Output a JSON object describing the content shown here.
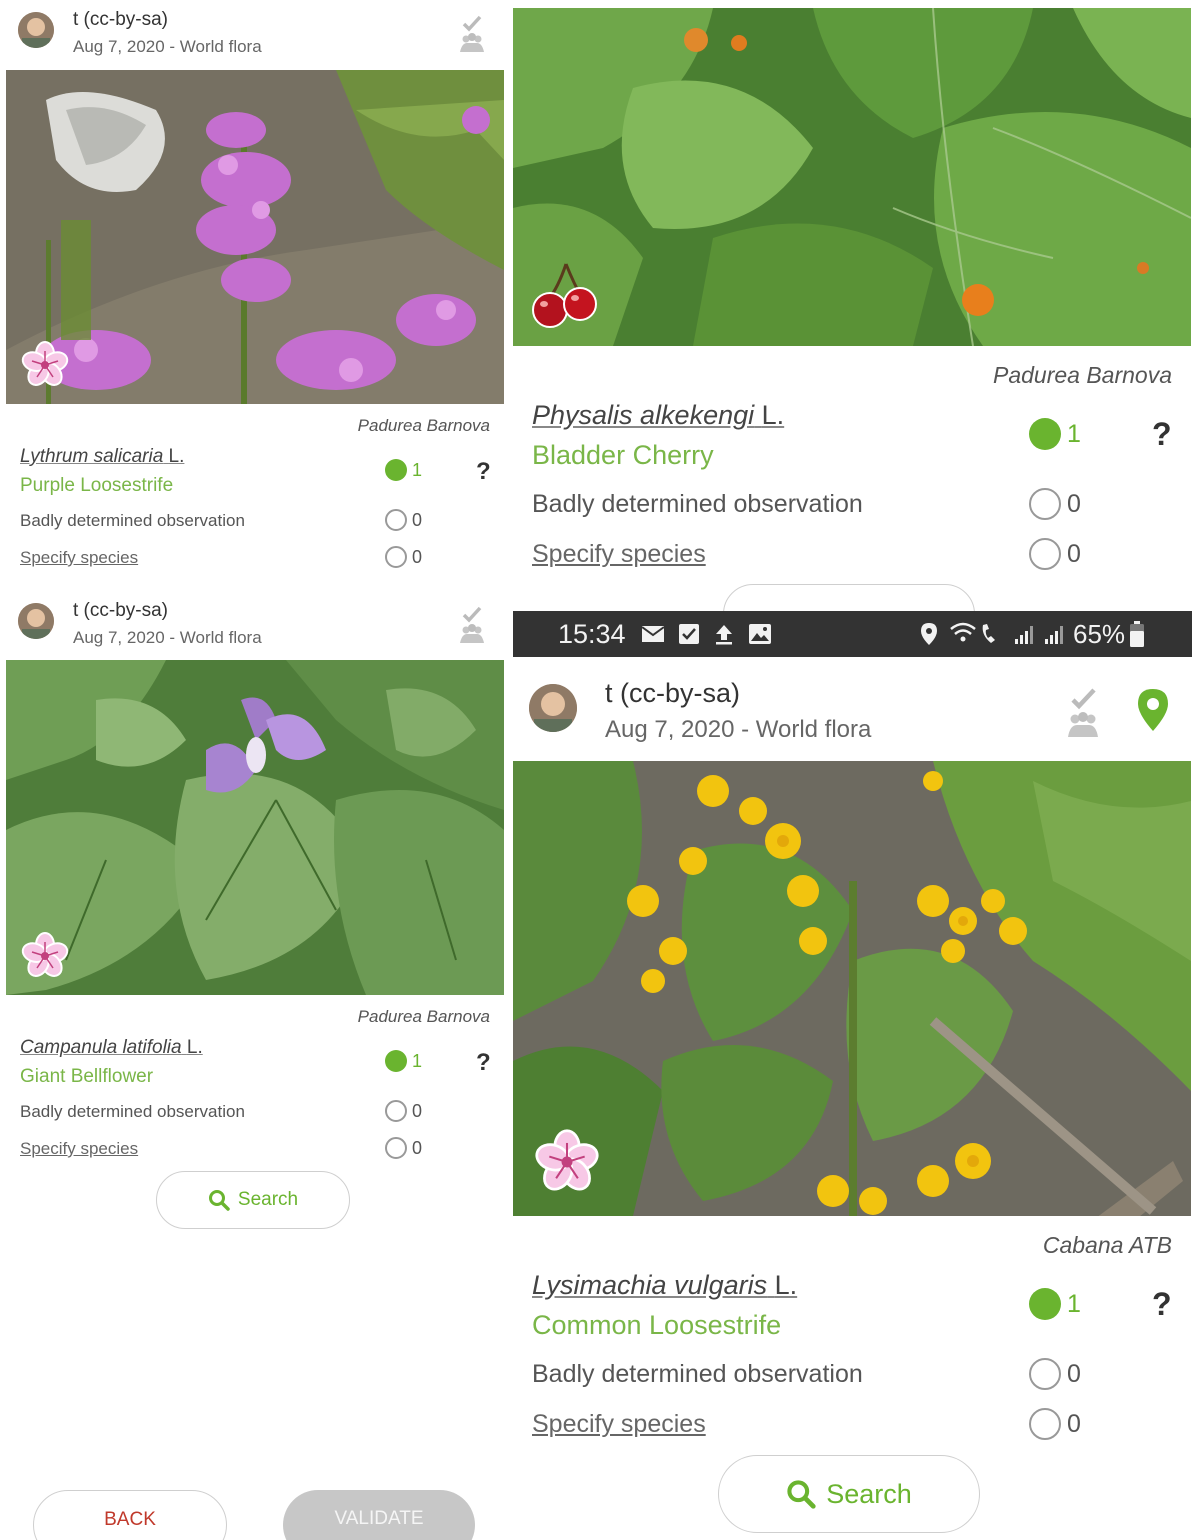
{
  "obs1": {
    "user": "t (cc-by-sa)",
    "meta": "Aug 7, 2020 - World flora",
    "location": "Padurea Barnova",
    "sci_name": "Lythrum salicaria",
    "author": "L.",
    "common": "Purple Loosestrife",
    "vote_yes": "1",
    "question": "?",
    "bad_label": "Badly determined observation",
    "bad_count": "0",
    "specify_label": "Specify species",
    "specify_count": "0"
  },
  "obs2": {
    "user": "t (cc-by-sa)",
    "meta": "Aug 7, 2020 - World flora",
    "location": "Padurea Barnova",
    "sci_name": "Campanula latifolia",
    "author": "L.",
    "common": "Giant Bellflower",
    "vote_yes": "1",
    "question": "?",
    "bad_label": "Badly determined observation",
    "bad_count": "0",
    "specify_label": "Specify species",
    "specify_count": "0",
    "search_label": "Search"
  },
  "bottom_buttons": {
    "back": "BACK",
    "validate": "VALIDATE"
  },
  "obs3": {
    "location": "Padurea Barnova",
    "sci_name": "Physalis alkekengi",
    "author": "L.",
    "common": "Bladder Cherry",
    "vote_yes": "1",
    "question": "?",
    "bad_label": "Badly determined observation",
    "bad_count": "0",
    "specify_label": "Specify species",
    "specify_count": "0"
  },
  "status_bar": {
    "time": "15:34",
    "battery": "65%"
  },
  "obs4": {
    "user": "t (cc-by-sa)",
    "meta": "Aug 7, 2020 - World flora",
    "location": "Cabana ATB",
    "sci_name": "Lysimachia vulgaris",
    "author": "L.",
    "common": "Common Loosestrife",
    "vote_yes": "1",
    "question": "?",
    "bad_label": "Badly determined observation",
    "bad_count": "0",
    "specify_label": "Specify species",
    "specify_count": "0",
    "search_label": "Search"
  },
  "colors": {
    "accent_green": "#6ab42f",
    "common_green": "#7ab648",
    "validate_gray": "#c7c7c7",
    "back_red": "#c0392b",
    "statusbar": "#333333"
  }
}
